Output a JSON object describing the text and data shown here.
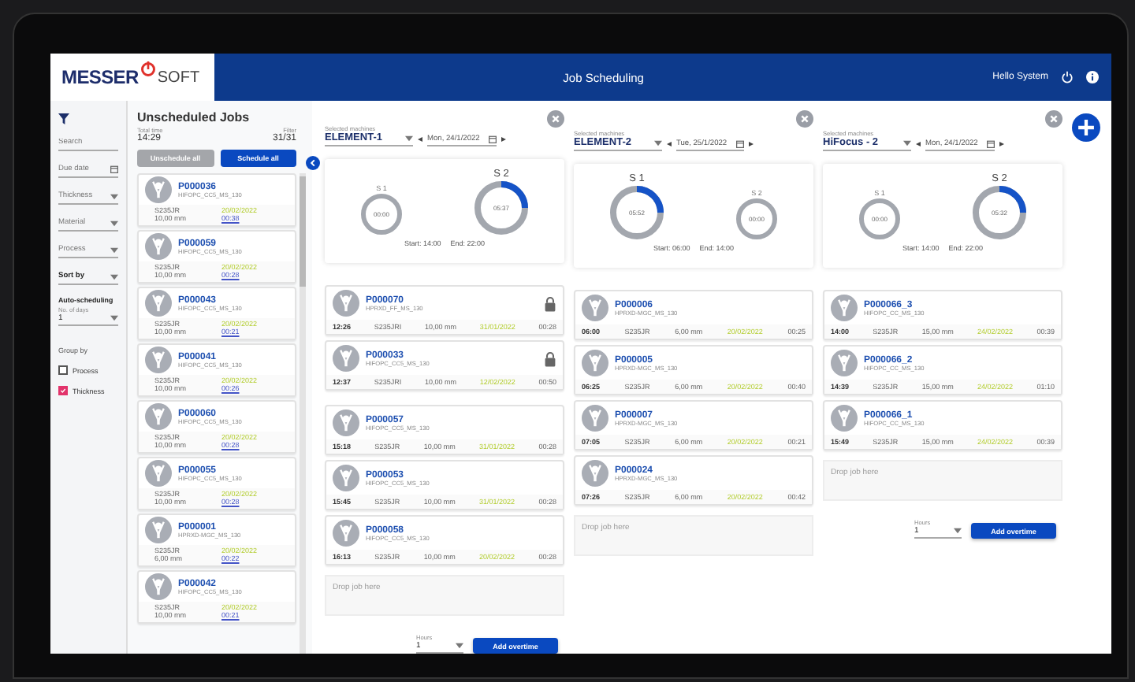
{
  "header": {
    "logo_left": "MESSER",
    "logo_right": "SOFT",
    "title": "Job Scheduling",
    "greeting": "Hello System"
  },
  "filters": {
    "search_placeholder": "Search",
    "fields": [
      {
        "kind": "date",
        "label": "Due date"
      },
      {
        "kind": "select",
        "label": "Thickness"
      },
      {
        "kind": "select",
        "label": "Material"
      },
      {
        "kind": "select",
        "label": "Process"
      },
      {
        "kind": "sort",
        "label": "Sort by"
      }
    ],
    "auto_scheduling": {
      "title": "Auto-scheduling",
      "days_label": "No. of days",
      "days_value": "1"
    },
    "group_by": {
      "title": "Group by",
      "options": [
        {
          "label": "Process",
          "checked": false
        },
        {
          "label": "Thickness",
          "checked": true
        }
      ]
    }
  },
  "unscheduled": {
    "title": "Unscheduled Jobs",
    "total_label": "Total time",
    "total": "14:29",
    "filter_label": "Filter",
    "filter": "31/31",
    "buttons": [
      {
        "label": "Unschedule all",
        "disabled": true
      },
      {
        "label": "Schedule all",
        "disabled": false
      }
    ],
    "jobs": [
      {
        "id": "P000036",
        "program": "HIFOPC_CC5_MS_130",
        "material": "S235JR",
        "thickness": "10,00 mm",
        "date": "20/02/2022",
        "duration": "00:38"
      },
      {
        "id": "P000059",
        "program": "HIFOPC_CC5_MS_130",
        "material": "S235JR",
        "thickness": "10,00 mm",
        "date": "20/02/2022",
        "duration": "00:28"
      },
      {
        "id": "P000043",
        "program": "HIFOPC_CC5_MS_130",
        "material": "S235JR",
        "thickness": "10,00 mm",
        "date": "20/02/2022",
        "duration": "00:21"
      },
      {
        "id": "P000041",
        "program": "HIFOPC_CC5_MS_130",
        "material": "S235JR",
        "thickness": "10,00 mm",
        "date": "20/02/2022",
        "duration": "00:26"
      },
      {
        "id": "P000060",
        "program": "HIFOPC_CC5_MS_130",
        "material": "S235JR",
        "thickness": "10,00 mm",
        "date": "20/02/2022",
        "duration": "00:28"
      },
      {
        "id": "P000055",
        "program": "HIFOPC_CC5_MS_130",
        "material": "S235JR",
        "thickness": "10,00 mm",
        "date": "20/02/2022",
        "duration": "00:28"
      },
      {
        "id": "P000001",
        "program": "HPRXD-MGC_MS_130",
        "material": "S235JR",
        "thickness": "6,00 mm",
        "date": "20/02/2022",
        "duration": "00:22"
      },
      {
        "id": "P000042",
        "program": "HIFOPC_CC5_MS_130",
        "material": "S235JR",
        "thickness": "10,00 mm",
        "date": "20/02/2022",
        "duration": "00:21"
      }
    ]
  },
  "machines": [
    {
      "label": "Selected machines",
      "machine": "ELEMENT-1",
      "date": "Mon, 24/1/2022",
      "shifts": [
        {
          "name": "S 1",
          "time": "00:00",
          "level": 0,
          "active": false
        },
        {
          "name": "S 2",
          "time": "05:37",
          "level": 0.25,
          "active": true
        }
      ],
      "start": "Start: 14:00",
      "end": "End: 22:00",
      "jobs": [
        {
          "id": "P000070",
          "program": "HPRXD_FF_MS_130",
          "locked": true,
          "time": "12:26",
          "material": "S235JRI",
          "thickness": "10,00 mm",
          "date": "31/01/2022",
          "duration": "00:28"
        },
        {
          "id": "P000033",
          "program": "HIFOPC_CC5_MS_130",
          "locked": true,
          "time": "12:37",
          "material": "S235JRI",
          "thickness": "10,00 mm",
          "date": "12/02/2022",
          "duration": "00:50"
        },
        {
          "id": "P000057",
          "program": "HIFOPC_CC5_MS_130",
          "locked": false,
          "time": "15:18",
          "material": "S235JR",
          "thickness": "10,00 mm",
          "date": "31/01/2022",
          "duration": "00:28"
        },
        {
          "id": "P000053",
          "program": "HIFOPC_CC5_MS_130",
          "locked": false,
          "time": "15:45",
          "material": "S235JR",
          "thickness": "10,00 mm",
          "date": "31/01/2022",
          "duration": "00:28"
        },
        {
          "id": "P000058",
          "program": "HIFOPC_CC5_MS_130",
          "locked": false,
          "time": "16:13",
          "material": "S235JR",
          "thickness": "10,00 mm",
          "date": "20/02/2022",
          "duration": "00:28"
        }
      ],
      "drop_hint": "Drop job here",
      "overtime": {
        "hours_label": "Hours",
        "hours": "1",
        "button": "Add overtime"
      }
    },
    {
      "label": "Selected machines",
      "machine": "ELEMENT-2",
      "date": "Tue, 25/1/2022",
      "shifts": [
        {
          "name": "S 1",
          "time": "05:52",
          "level": 0.25,
          "active": true
        },
        {
          "name": "S 2",
          "time": "00:00",
          "level": 0,
          "active": false
        }
      ],
      "start": "Start: 06:00",
      "end": "End: 14:00",
      "jobs": [
        {
          "id": "P000006",
          "program": "HPRXD-MGC_MS_130",
          "locked": false,
          "time": "06:00",
          "material": "S235JR",
          "thickness": "6,00 mm",
          "date": "20/02/2022",
          "duration": "00:25"
        },
        {
          "id": "P000005",
          "program": "HPRXD-MGC_MS_130",
          "locked": false,
          "time": "06:25",
          "material": "S235JR",
          "thickness": "6,00 mm",
          "date": "20/02/2022",
          "duration": "00:40"
        },
        {
          "id": "P000007",
          "program": "HPRXD-MGC_MS_130",
          "locked": false,
          "time": "07:05",
          "material": "S235JR",
          "thickness": "6,00 mm",
          "date": "20/02/2022",
          "duration": "00:21"
        },
        {
          "id": "P000024",
          "program": "HPRXD-MGC_MS_130",
          "locked": false,
          "time": "07:26",
          "material": "S235JR",
          "thickness": "6,00 mm",
          "date": "20/02/2022",
          "duration": "00:42"
        }
      ],
      "drop_hint": "Drop job here"
    },
    {
      "label": "Selected machines",
      "machine": "HiFocus - 2",
      "date": "Mon, 24/1/2022",
      "shifts": [
        {
          "name": "S 1",
          "time": "00:00",
          "level": 0,
          "active": false
        },
        {
          "name": "S 2",
          "time": "05:32",
          "level": 0.25,
          "active": true
        }
      ],
      "start": "Start: 14:00",
      "end": "End: 22:00",
      "jobs": [
        {
          "id": "P000066_3",
          "program": "HIFOPC_CC_MS_130",
          "locked": false,
          "time": "14:00",
          "material": "S235JR",
          "thickness": "15,00 mm",
          "date": "24/02/2022",
          "duration": "00:39"
        },
        {
          "id": "P000066_2",
          "program": "HIFOPC_CC_MS_130",
          "locked": false,
          "time": "14:39",
          "material": "S235JR",
          "thickness": "15,00 mm",
          "date": "24/02/2022",
          "duration": "01:10"
        },
        {
          "id": "P000066_1",
          "program": "HIFOPC_CC_MS_130",
          "locked": false,
          "time": "15:49",
          "material": "S235JR",
          "thickness": "15,00 mm",
          "date": "24/02/2022",
          "duration": "00:39"
        }
      ],
      "drop_hint": "Drop job here",
      "overtime": {
        "hours_label": "Hours",
        "hours": "1",
        "button": "Add overtime"
      }
    }
  ]
}
